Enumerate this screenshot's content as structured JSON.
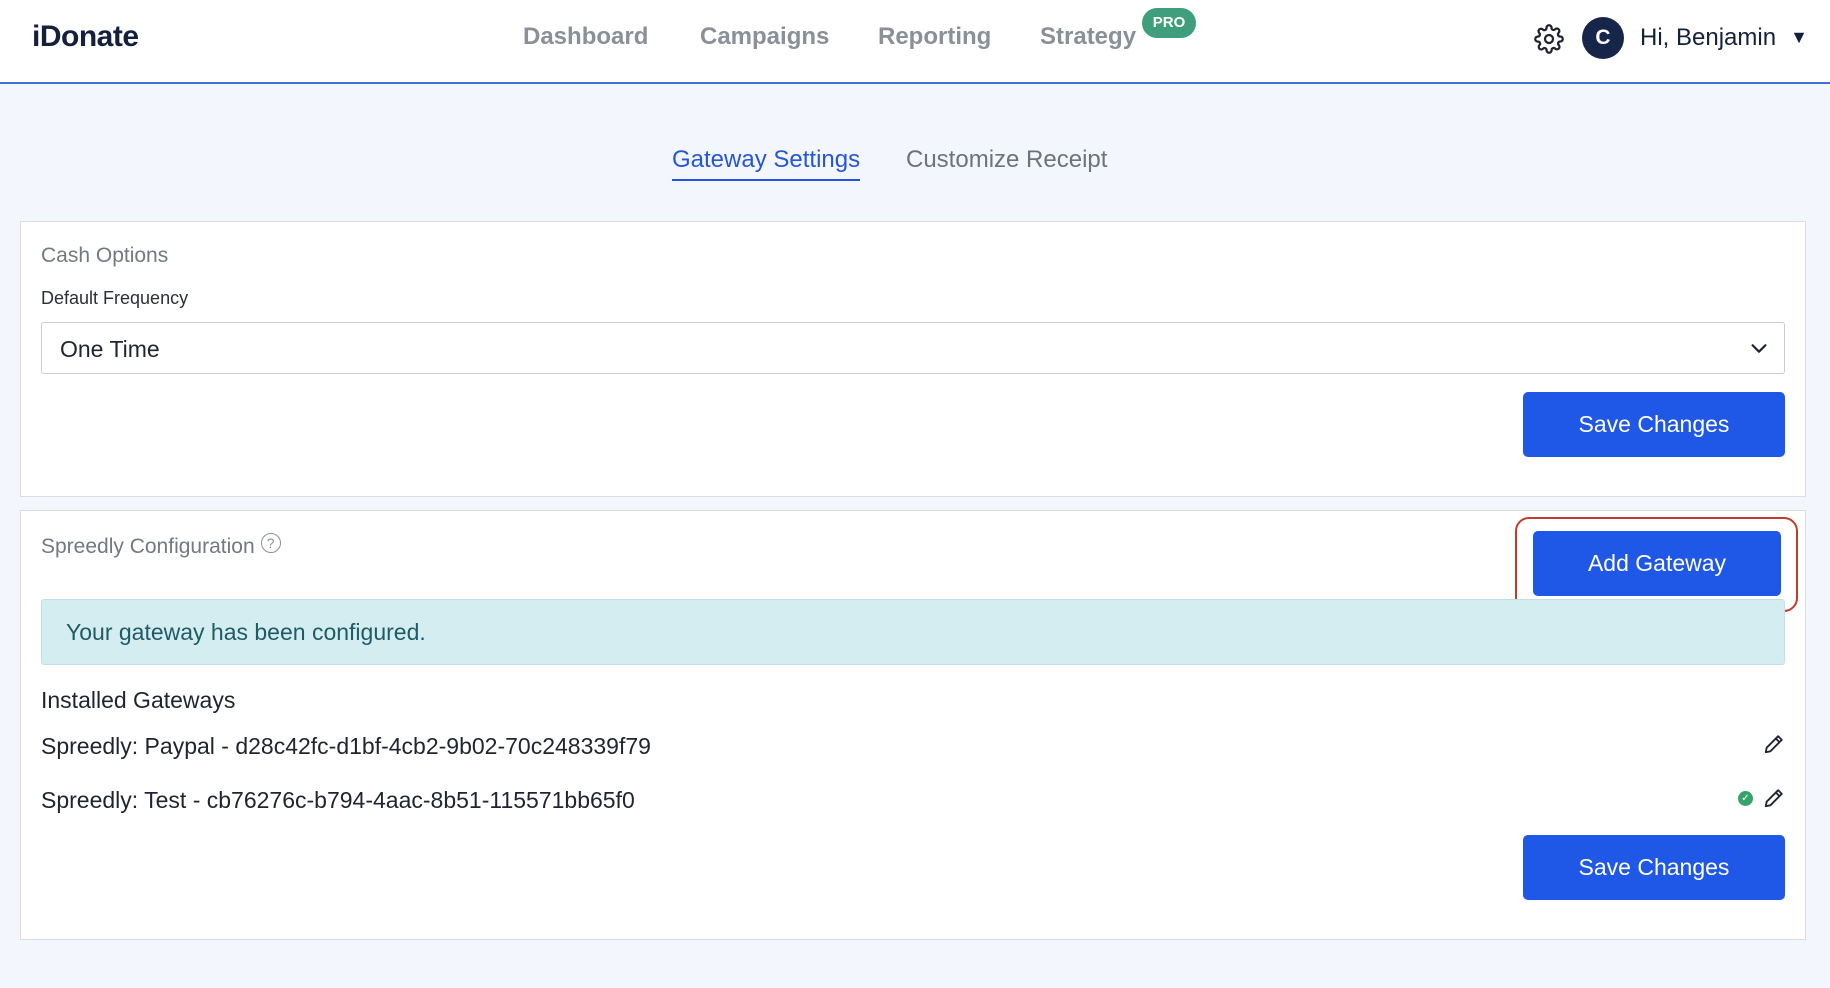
{
  "header": {
    "logo": "iDonate",
    "nav": [
      "Dashboard",
      "Campaigns",
      "Reporting",
      "Strategy"
    ],
    "pro_badge": "PRO",
    "avatar_initial": "C",
    "greeting": "Hi, Benjamin"
  },
  "tabs": {
    "active": "Gateway Settings",
    "inactive": "Customize Receipt"
  },
  "cash_options": {
    "title": "Cash Options",
    "frequency_label": "Default Frequency",
    "frequency_value": "One Time",
    "save_label": "Save Changes"
  },
  "spreedly": {
    "title": "Spreedly Configuration",
    "help": "?",
    "add_gateway_label": "Add Gateway",
    "alert": "Your gateway has been configured.",
    "installed_label": "Installed Gateways",
    "gateways": [
      {
        "text": "Spreedly: Paypal - d28c42fc-d1bf-4cb2-9b02-70c248339f79",
        "active": false
      },
      {
        "text": "Spreedly: Test - cb76276c-b794-4aac-8b51-115571bb65f0",
        "active": true
      }
    ],
    "save_label": "Save Changes"
  },
  "colors": {
    "primary": "#1f58e6",
    "link_active": "#2456d9",
    "pro_badge": "#3f9e7c",
    "alert_bg": "#d4edf0",
    "highlight": "#c23c2a"
  }
}
